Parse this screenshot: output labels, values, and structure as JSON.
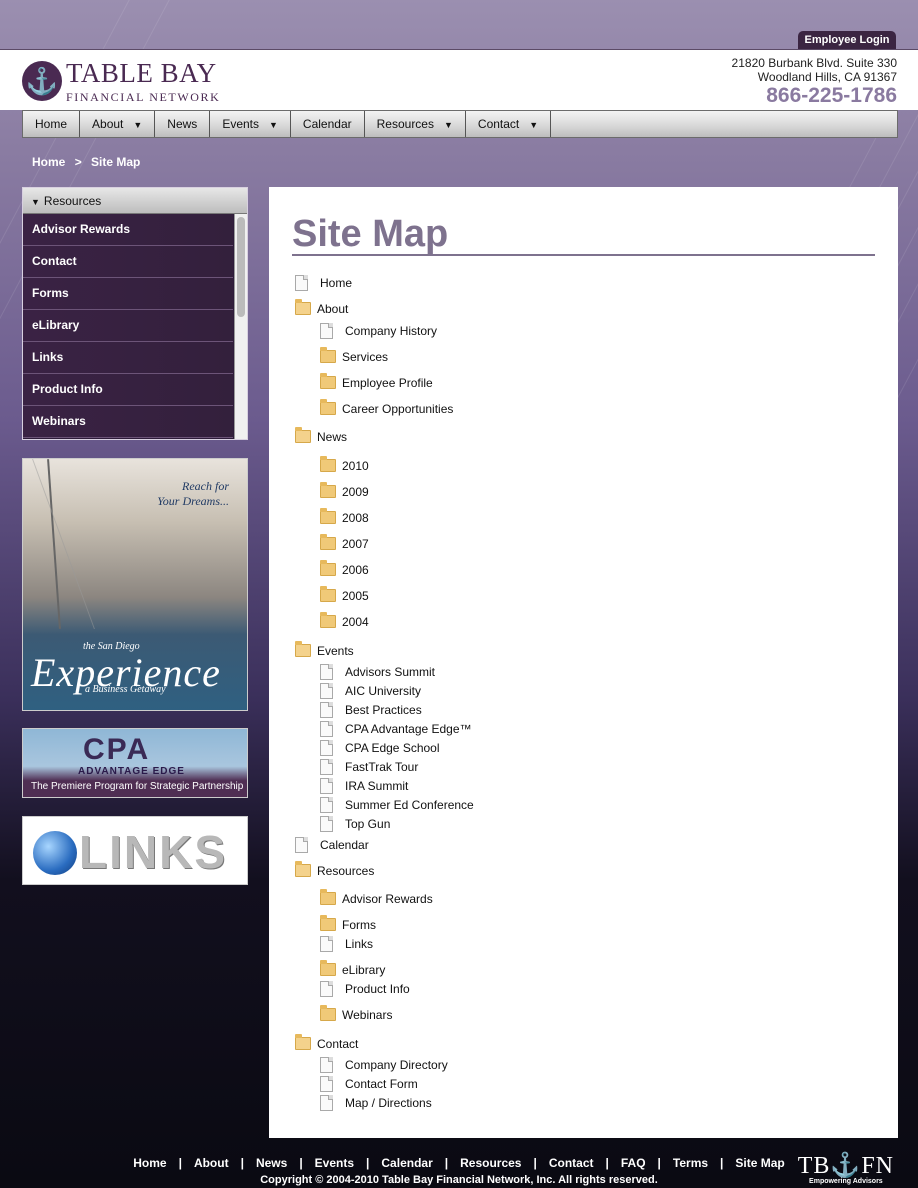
{
  "login": {
    "label": "Employee Login"
  },
  "brand": {
    "name": "TABLE BAY",
    "subtitle": "FINANCIAL NETWORK",
    "address_line1": "21820 Burbank Blvd. Suite 330",
    "address_line2": "Woodland Hills, CA 91367",
    "phone": "866-225-1786"
  },
  "nav": {
    "items": [
      {
        "label": "Home",
        "dropdown": false
      },
      {
        "label": "About",
        "dropdown": true
      },
      {
        "label": "News",
        "dropdown": false
      },
      {
        "label": "Events",
        "dropdown": true
      },
      {
        "label": "Calendar",
        "dropdown": false
      },
      {
        "label": "Resources",
        "dropdown": true
      },
      {
        "label": "Contact",
        "dropdown": true
      }
    ]
  },
  "breadcrumb": {
    "home": "Home",
    "separator": ">",
    "current": "Site Map"
  },
  "sidebar": {
    "header": "Resources",
    "items": [
      "Advisor Rewards",
      "Contact",
      "Forms",
      "eLibrary",
      "Links",
      "Product Info",
      "Webinars"
    ]
  },
  "promos": {
    "experience": {
      "tagline_1": "Reach for",
      "tagline_2": "Your Dreams...",
      "city": "the San Diego",
      "title": "Experience",
      "sub": "a Business Getaway"
    },
    "cpa": {
      "title": "CPA",
      "subtitle": "ADVANTAGE EDGE",
      "banner": "The Premiere Program for Strategic Partnership"
    },
    "links": {
      "title": "LINKS"
    }
  },
  "page": {
    "title": "Site Map"
  },
  "sitemap": [
    {
      "label": "Home",
      "type": "doc",
      "level": 0
    },
    {
      "label": "About",
      "type": "folder-open",
      "level": 0
    },
    {
      "label": "Company History",
      "type": "doc",
      "level": 1
    },
    {
      "label": "Services",
      "type": "folder",
      "level": 1
    },
    {
      "label": "Employee Profile",
      "type": "folder",
      "level": 1
    },
    {
      "label": "Career Opportunities",
      "type": "folder",
      "level": 1
    },
    {
      "label": "News",
      "type": "folder-open",
      "level": 0
    },
    {
      "label": "2010",
      "type": "folder",
      "level": 1
    },
    {
      "label": "2009",
      "type": "folder",
      "level": 1
    },
    {
      "label": "2008",
      "type": "folder",
      "level": 1
    },
    {
      "label": "2007",
      "type": "folder",
      "level": 1
    },
    {
      "label": "2006",
      "type": "folder",
      "level": 1
    },
    {
      "label": "2005",
      "type": "folder",
      "level": 1
    },
    {
      "label": "2004",
      "type": "folder",
      "level": 1
    },
    {
      "label": "Events",
      "type": "folder-open",
      "level": 0
    },
    {
      "label": "Advisors Summit",
      "type": "doc",
      "level": 1
    },
    {
      "label": "AIC University",
      "type": "doc",
      "level": 1
    },
    {
      "label": "Best Practices",
      "type": "doc",
      "level": 1
    },
    {
      "label": "CPA Advantage Edge™",
      "type": "doc",
      "level": 1
    },
    {
      "label": "CPA Edge School",
      "type": "doc",
      "level": 1
    },
    {
      "label": "FastTrak Tour",
      "type": "doc",
      "level": 1
    },
    {
      "label": "IRA Summit",
      "type": "doc",
      "level": 1
    },
    {
      "label": "Summer Ed Conference",
      "type": "doc",
      "level": 1
    },
    {
      "label": "Top Gun",
      "type": "doc",
      "level": 1
    },
    {
      "label": "Calendar",
      "type": "doc",
      "level": 0
    },
    {
      "label": "Resources",
      "type": "folder-open",
      "level": 0
    },
    {
      "label": "Advisor Rewards",
      "type": "folder",
      "level": 1
    },
    {
      "label": "Forms",
      "type": "folder",
      "level": 1
    },
    {
      "label": "Links",
      "type": "doc",
      "level": 1
    },
    {
      "label": "eLibrary",
      "type": "folder",
      "level": 1
    },
    {
      "label": "Product Info",
      "type": "doc",
      "level": 1
    },
    {
      "label": "Webinars",
      "type": "folder",
      "level": 1
    },
    {
      "label": "Contact",
      "type": "folder-open",
      "level": 0
    },
    {
      "label": "Company Directory",
      "type": "doc",
      "level": 1
    },
    {
      "label": "Contact Form",
      "type": "doc",
      "level": 1
    },
    {
      "label": "Map / Directions",
      "type": "doc",
      "level": 1
    }
  ],
  "footer": {
    "links": [
      "Home",
      "About",
      "News",
      "Events",
      "Calendar",
      "Resources",
      "Contact",
      "FAQ",
      "Terms",
      "Site Map"
    ],
    "separator": "|",
    "copyright": "Copyright © 2004-2010 Table Bay Financial Network, Inc. All rights reserved.",
    "logo_mark": "TB⚓FN",
    "logo_tagline": "Empowering Advisors"
  }
}
